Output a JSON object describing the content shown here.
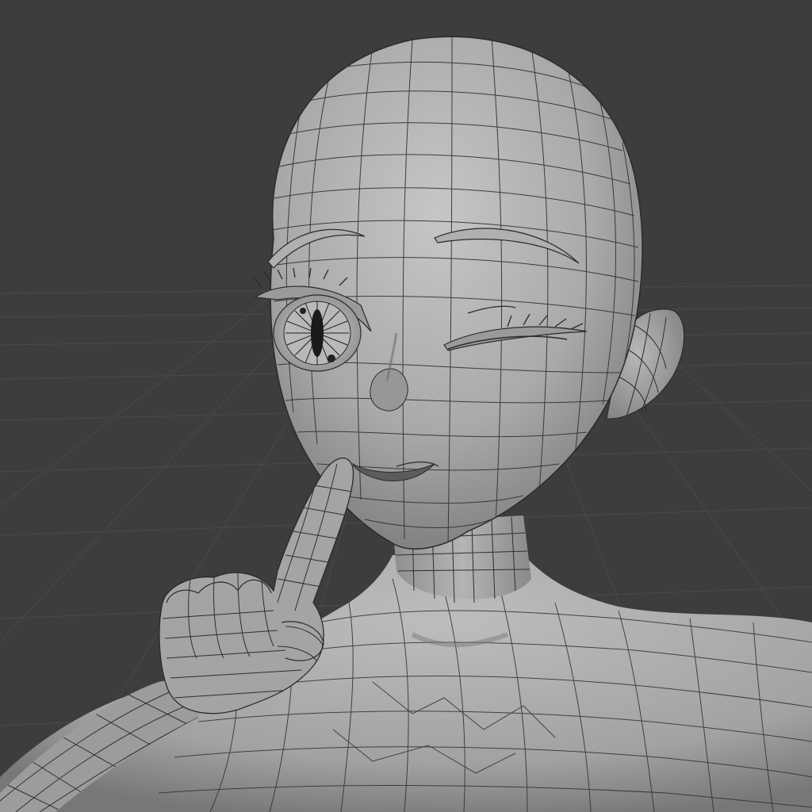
{
  "scene": {
    "background_color": "#3d3d3d",
    "grid_color": "#4c4c4c",
    "mesh_fill": "#a8a8a8",
    "mesh_highlight": "#c4c4c4",
    "mesh_shadow": "#6e6e6e",
    "wire_color": "#2a2a2a",
    "shading": "solid-with-wireframe",
    "subject": "character-mesh",
    "pose": "finger-to-lips-wink"
  }
}
